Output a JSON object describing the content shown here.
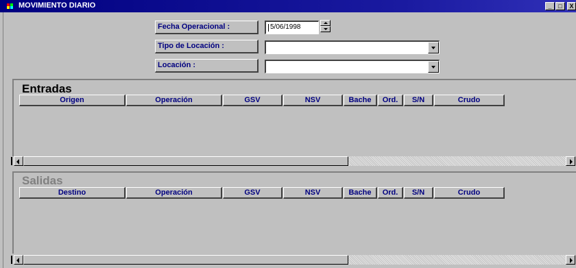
{
  "window": {
    "title": "MOVIMIENTO DIARIO",
    "controls": {
      "minimize": "_",
      "maximize": "□",
      "close": "X"
    }
  },
  "filters": {
    "fecha_label": "Fecha Operacional :",
    "fecha_value": "5/06/1998",
    "tipo_label": "Tipo de Locación :",
    "tipo_value": "",
    "locacion_label": "Locación :",
    "locacion_value": ""
  },
  "entradas": {
    "title": "Entradas",
    "columns": [
      "Origen",
      "Operación",
      "GSV",
      "NSV",
      "Bache",
      "Ord.",
      "S/N",
      "Crudo"
    ],
    "rows": []
  },
  "salidas": {
    "title": "Salidas",
    "columns": [
      "Destino",
      "Operación",
      "GSV",
      "NSV",
      "Bache",
      "Ord.",
      "S/N",
      "Crudo"
    ],
    "rows": []
  },
  "colors": {
    "titlebar": "#000080",
    "label_text": "#000080",
    "window_bg": "#c0c0c0",
    "salidas_title_disabled": "#808080"
  }
}
